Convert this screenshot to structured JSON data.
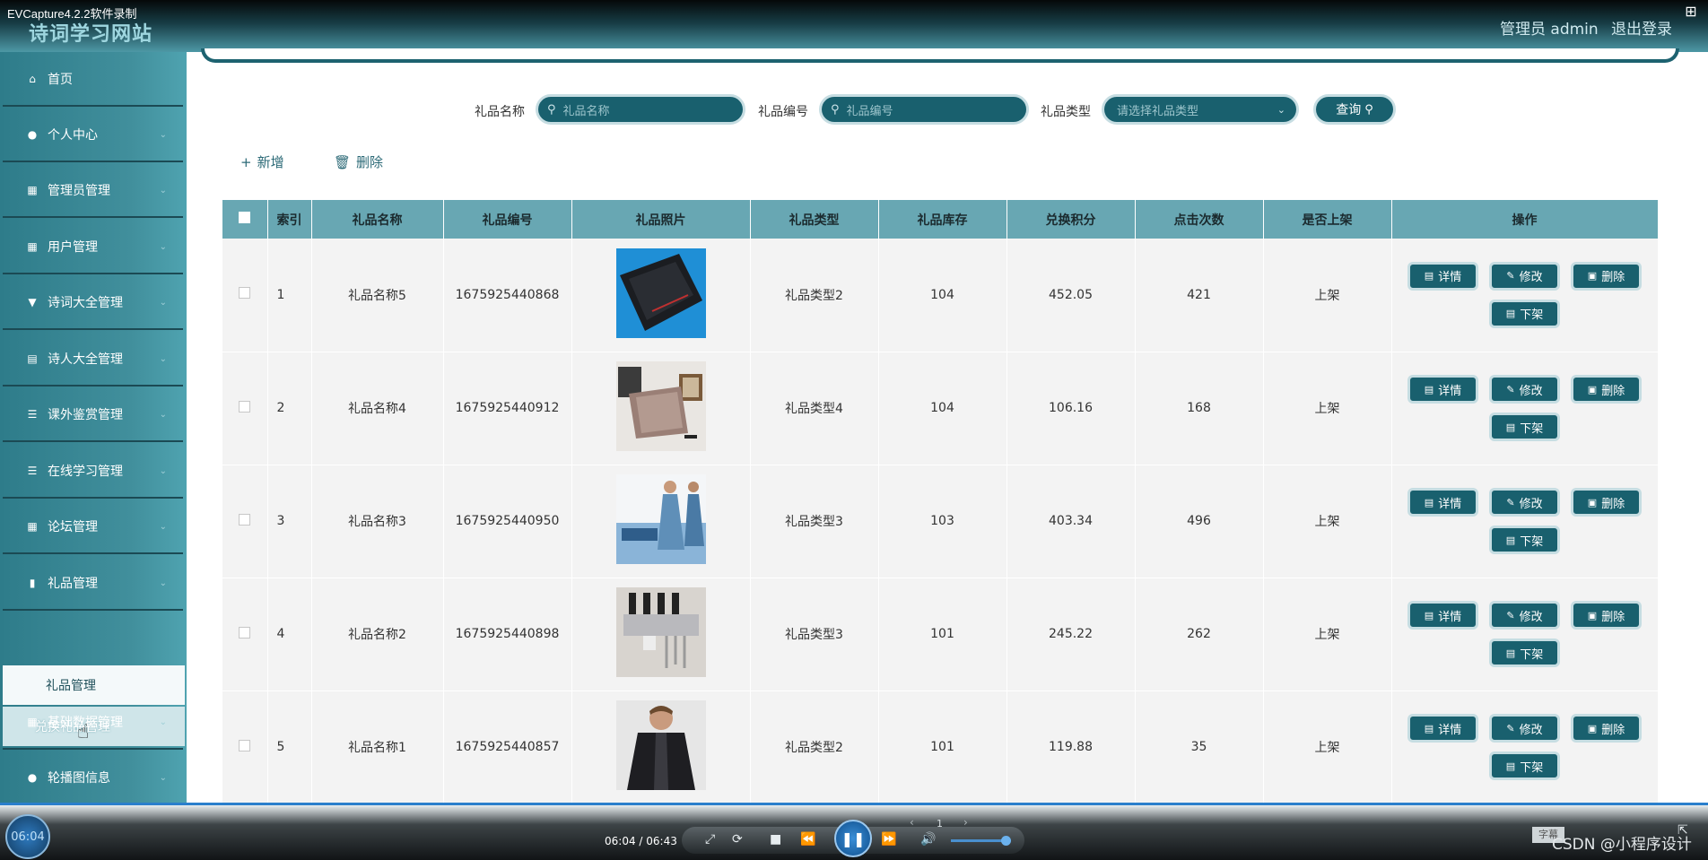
{
  "recorder": {
    "title": "EVCapture4.2.2软件录制"
  },
  "header": {
    "site_title": "诗词学习网站",
    "admin_label": "管理员 admin",
    "logout_label": "退出登录"
  },
  "sidebar": {
    "items": [
      {
        "label": "首页",
        "icon": "home-icon",
        "has_chevron": false
      },
      {
        "label": "个人中心",
        "icon": "user-icon",
        "has_chevron": true
      },
      {
        "label": "管理员管理",
        "icon": "grid-icon",
        "has_chevron": true
      },
      {
        "label": "用户管理",
        "icon": "grid-icon",
        "has_chevron": true
      },
      {
        "label": "诗词大全管理",
        "icon": "pin-icon",
        "has_chevron": true
      },
      {
        "label": "诗人大全管理",
        "icon": "clipboard-icon",
        "has_chevron": true
      },
      {
        "label": "课外鉴赏管理",
        "icon": "list-icon",
        "has_chevron": true
      },
      {
        "label": "在线学习管理",
        "icon": "list-icon",
        "has_chevron": true
      },
      {
        "label": "论坛管理",
        "icon": "grid-icon",
        "has_chevron": true
      },
      {
        "label": "礼品管理",
        "icon": "bar-chart-icon",
        "has_chevron": true
      },
      {
        "label": "基础数据管理",
        "icon": "grid-icon",
        "has_chevron": true
      },
      {
        "label": "轮播图信息",
        "icon": "location-icon",
        "has_chevron": true
      }
    ],
    "submenu": [
      {
        "label": "礼品管理"
      },
      {
        "label": "兑换礼品管理"
      }
    ]
  },
  "search": {
    "name_label": "礼品名称",
    "name_placeholder": "礼品名称",
    "code_label": "礼品编号",
    "code_placeholder": "礼品编号",
    "type_label": "礼品类型",
    "type_placeholder": "请选择礼品类型",
    "query_label": "查询"
  },
  "actions": {
    "add_label": "新增",
    "delete_label": "删除"
  },
  "table": {
    "headers": [
      "索引",
      "礼品名称",
      "礼品编号",
      "礼品照片",
      "礼品类型",
      "礼品库存",
      "兑换积分",
      "点击次数",
      "是否上架",
      "操作"
    ],
    "rows": [
      {
        "index": "1",
        "name": "礼品名称5",
        "code": "1675925440868",
        "photo": "laptop-photo",
        "type": "礼品类型2",
        "stock": "104",
        "points": "452.05",
        "clicks": "421",
        "listed": "上架"
      },
      {
        "index": "2",
        "name": "礼品名称4",
        "code": "1675925440912",
        "photo": "laptop-photo",
        "type": "礼品类型4",
        "stock": "104",
        "points": "106.16",
        "clicks": "168",
        "listed": "上架"
      },
      {
        "index": "3",
        "name": "礼品名称3",
        "code": "1675925440950",
        "photo": "dress-photo",
        "type": "礼品类型3",
        "stock": "103",
        "points": "403.34",
        "clicks": "496",
        "listed": "上架"
      },
      {
        "index": "4",
        "name": "礼品名称2",
        "code": "1675925440898",
        "photo": "kitchen-rack-photo",
        "type": "礼品类型3",
        "stock": "101",
        "points": "245.22",
        "clicks": "262",
        "listed": "上架"
      },
      {
        "index": "5",
        "name": "礼品名称1",
        "code": "1675925440857",
        "photo": "jacket-photo",
        "type": "礼品类型2",
        "stock": "101",
        "points": "119.88",
        "clicks": "35",
        "listed": "上架"
      }
    ],
    "row_buttons": {
      "detail": "详情",
      "edit": "修改",
      "delete": "删除",
      "unlist": "下架"
    }
  },
  "player": {
    "disc_time": "06:04",
    "time_text": "06:04 / 06:43",
    "page_number": "1",
    "watermark": "CSDN @小程序设计",
    "small_box": "字幕"
  },
  "colors": {
    "accent": "#19606e",
    "header_row": "#68a7b3",
    "sidebar": "#418f9c"
  }
}
